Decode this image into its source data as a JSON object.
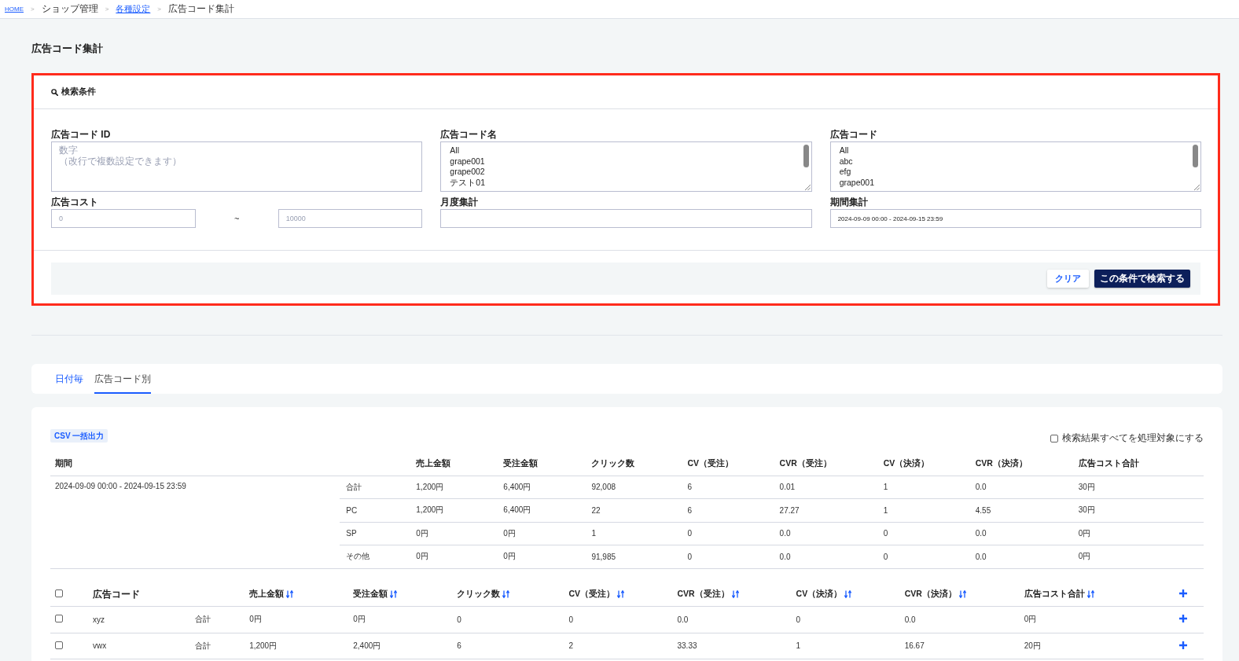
{
  "breadcrumb": [
    {
      "label": "HOME",
      "kind": "link"
    },
    {
      "separator": ">",
      "label": "ショップ管理",
      "kind": "text"
    },
    {
      "separator": ">",
      "label": "各種設定",
      "kind": "link"
    },
    {
      "separator": ">",
      "label": "広告コード集計",
      "kind": "text"
    }
  ],
  "page_title": "広告コード集計",
  "search_panel": {
    "highlighted": true,
    "title": "検索条件",
    "fields": [
      {
        "kind": "textarea",
        "label": "広告コード ID",
        "placeholder": [
          "数字",
          "（改行で複数設定できます）"
        ]
      },
      {
        "kind": "listbox",
        "label": "広告コード名",
        "options": [
          "All",
          "grape001",
          "grape002",
          "テスト01"
        ]
      },
      {
        "kind": "listbox",
        "label": "広告コード",
        "options": [
          "All",
          "abc",
          "efg",
          "grape001"
        ]
      },
      {
        "kind": "range",
        "label": "広告コスト",
        "min": {
          "placeholder": "0"
        },
        "separator": "~",
        "max": {
          "placeholder": "10000"
        }
      },
      {
        "kind": "text",
        "label": "月度集計"
      },
      {
        "kind": "text",
        "label": "期間集計",
        "value": "2024-09-09 00:00 - 2024-09-15 23:59"
      }
    ],
    "buttons": [
      {
        "kind": "secondary",
        "label": "クリア"
      },
      {
        "kind": "primary",
        "label": "この条件で検索する"
      }
    ]
  },
  "tabs": [
    {
      "label": "日付毎",
      "selected": false
    },
    {
      "label": "広告コード別",
      "selected": true
    }
  ],
  "results": {
    "csv_button": "CSV 一括出力",
    "select_all": {
      "label": "検索結果すべてを処理対象にする",
      "checked": false
    },
    "summary": {
      "period_label": "期間",
      "columns": [
        "売上金額",
        "受注金額",
        "クリック数",
        "CV（受注）",
        "CVR（受注）",
        "CV（決済）",
        "CVR（決済）",
        "広告コスト合計"
      ],
      "period": "2024-09-09 00:00 - 2024-09-15 23:59",
      "rows": [
        {
          "device": "合計",
          "values": [
            "1,200円",
            "6,400円",
            "92,008",
            "6",
            "0.01",
            "1",
            "0.0",
            "30円"
          ]
        },
        {
          "device": "PC",
          "values": [
            "1,200円",
            "6,400円",
            "22",
            "6",
            "27.27",
            "1",
            "4.55",
            "30円"
          ]
        },
        {
          "device": "SP",
          "values": [
            "0円",
            "0円",
            "1",
            "0",
            "0.0",
            "0",
            "0.0",
            "0円"
          ]
        },
        {
          "device": "その他",
          "values": [
            "0円",
            "0円",
            "91,985",
            "0",
            "0.0",
            "0",
            "0.0",
            "0円"
          ]
        }
      ]
    },
    "codes": {
      "header_checked": false,
      "columns": [
        {
          "label": "広告コード",
          "sortable": false
        },
        {
          "label": "売上金額",
          "sortable": true
        },
        {
          "label": "受注金額",
          "sortable": true
        },
        {
          "label": "クリック数",
          "sortable": true
        },
        {
          "label": "CV（受注）",
          "sortable": true
        },
        {
          "label": "CVR（受注）",
          "sortable": true
        },
        {
          "label": "CV（決済）",
          "sortable": true
        },
        {
          "label": "CVR（決済）",
          "sortable": true
        },
        {
          "label": "広告コスト合計",
          "sortable": true
        }
      ],
      "rows": [
        {
          "checked": false,
          "code": "xyz",
          "type": "合計",
          "values": [
            "0円",
            "0円",
            "0",
            "0",
            "0.0",
            "0",
            "0.0",
            "0円"
          ]
        },
        {
          "checked": false,
          "code": "vwx",
          "type": "合計",
          "values": [
            "1,200円",
            "2,400円",
            "6",
            "2",
            "33.33",
            "1",
            "16.67",
            "20円"
          ]
        }
      ]
    }
  }
}
